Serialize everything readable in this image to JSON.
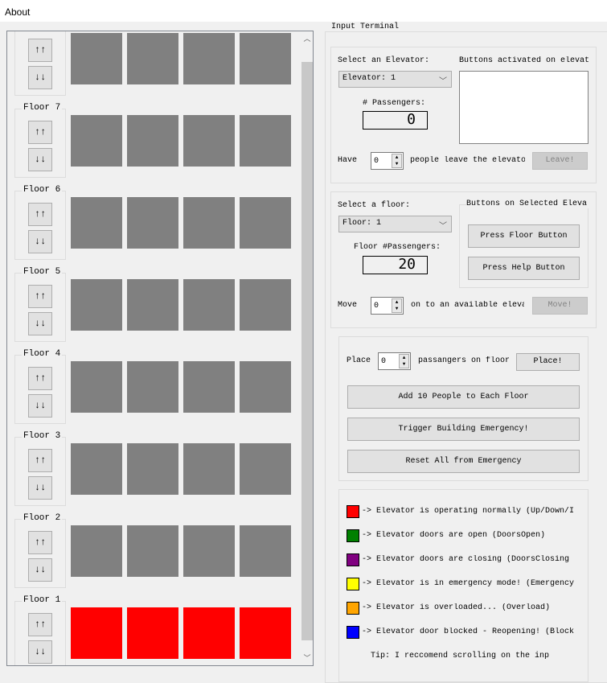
{
  "menu": {
    "about": "About"
  },
  "floors": [
    {
      "label": "",
      "up": "↑↑",
      "down": "↓↓",
      "elevators": [
        "#808080",
        "#808080",
        "#808080",
        "#808080"
      ]
    },
    {
      "label": "Floor 7",
      "up": "↑↑",
      "down": "↓↓",
      "elevators": [
        "#808080",
        "#808080",
        "#808080",
        "#808080"
      ]
    },
    {
      "label": "Floor 6",
      "up": "↑↑",
      "down": "↓↓",
      "elevators": [
        "#808080",
        "#808080",
        "#808080",
        "#808080"
      ]
    },
    {
      "label": "Floor 5",
      "up": "↑↑",
      "down": "↓↓",
      "elevators": [
        "#808080",
        "#808080",
        "#808080",
        "#808080"
      ]
    },
    {
      "label": "Floor 4",
      "up": "↑↑",
      "down": "↓↓",
      "elevators": [
        "#808080",
        "#808080",
        "#808080",
        "#808080"
      ]
    },
    {
      "label": "Floor 3",
      "up": "↑↑",
      "down": "↓↓",
      "elevators": [
        "#808080",
        "#808080",
        "#808080",
        "#808080"
      ]
    },
    {
      "label": "Floor 2",
      "up": "↑↑",
      "down": "↓↓",
      "elevators": [
        "#808080",
        "#808080",
        "#808080",
        "#808080"
      ]
    },
    {
      "label": "Floor 1",
      "up": "↑↑",
      "down": "↓↓",
      "elevators": [
        "#ff0000",
        "#ff0000",
        "#ff0000",
        "#ff0000"
      ]
    }
  ],
  "terminal": {
    "title": "Input Terminal",
    "elevator": {
      "select_label": "Select an Elevator:",
      "selected": "Elevator: 1",
      "buttons_label": "Buttons activated on elevat",
      "passengers_label": "# Passengers:",
      "passengers": "0",
      "have_label": "Have",
      "leave_value": "0",
      "leave_text": "people leave the elevato",
      "leave_button": "Leave!"
    },
    "floor": {
      "select_label": "Select a floor:",
      "selected": "Floor: 1",
      "passengers_label": "Floor #Passengers:",
      "passengers": "20",
      "buttons_group": "Buttons on Selected Eleva",
      "press_floor": "Press Floor Button",
      "press_help": "Press Help Button",
      "move_label": "Move",
      "move_value": "0",
      "move_text": "on to an available eleva",
      "move_button": "Move!"
    },
    "place": {
      "label": "Place",
      "value": "0",
      "text": "passangers on floor",
      "button": "Place!",
      "add10": "Add 10 People to Each Floor",
      "emergency": "Trigger Building Emergency!",
      "reset": "Reset All from Emergency"
    },
    "legend": [
      {
        "color": "#ff0000",
        "text": "-> Elevator is operating normally (Up/Down/I"
      },
      {
        "color": "#008000",
        "text": "-> Elevator doors are open (DoorsOpen)"
      },
      {
        "color": "#800080",
        "text": "-> Elevator doors are closing  (DoorsClosing"
      },
      {
        "color": "#ffff00",
        "text": "-> Elevator is in emergency mode! (Emergency"
      },
      {
        "color": "#ffa500",
        "text": "-> Elevator is overloaded...  (Overload)"
      },
      {
        "color": "#0000ff",
        "text": "-> Elevator door blocked - Reopening! (Block"
      }
    ],
    "tip": "Tip: I reccomend scrolling on the inp"
  }
}
